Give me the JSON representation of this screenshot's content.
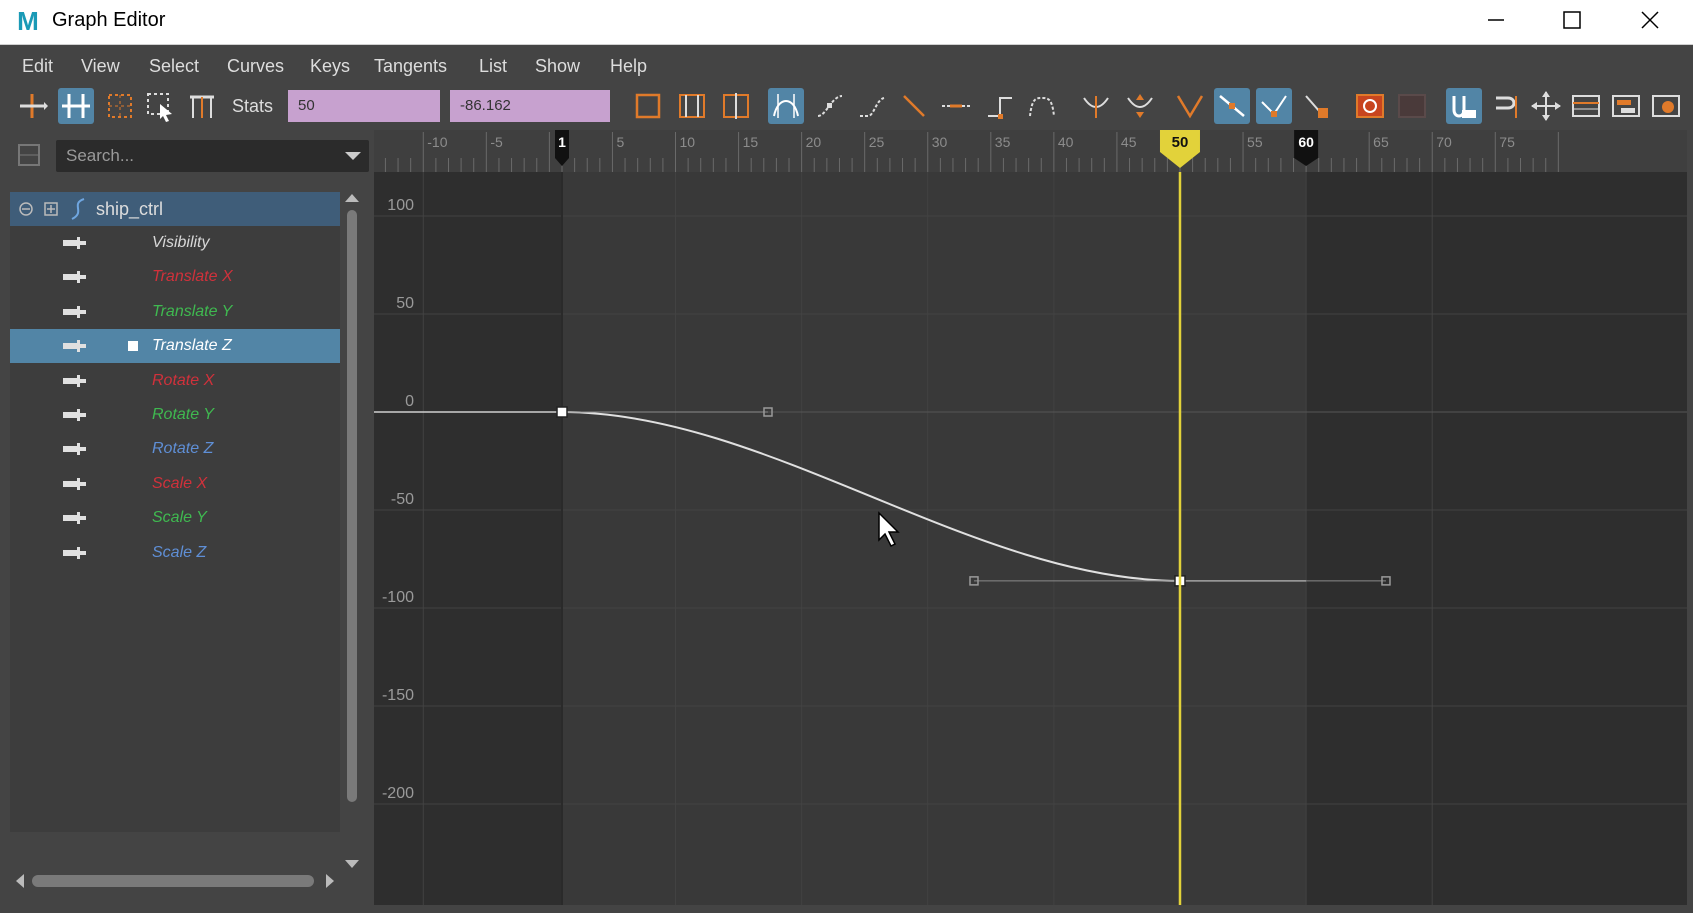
{
  "window": {
    "title": "Graph Editor",
    "logo_letter": "M",
    "controls": [
      "minimize-icon",
      "maximize-icon",
      "close-icon"
    ]
  },
  "menu": [
    "Edit",
    "View",
    "Select",
    "Curves",
    "Keys",
    "Tangents",
    "List",
    "Show",
    "Help"
  ],
  "toolbar": {
    "stats_label": "Stats",
    "frame_value": "50",
    "value_field": "-86.162",
    "tools": [
      "move-nearest-key-icon",
      "insert-keys-icon",
      "lattice-deform-icon",
      "region-select-icon",
      "retime-icon",
      "frame-all-icon",
      "frame-playback-icon",
      "center-current-time-icon",
      "auto-tangent-icon",
      "spline-tangent-icon",
      "clamped-tangent-icon",
      "linear-tangent-icon",
      "flat-tangent-icon",
      "step-tangent-icon",
      "plateau-tangent-icon",
      "buffer-curve-snapshot-icon",
      "swap-buffer-curve-icon",
      "break-tangents-icon",
      "unify-tangents-icon",
      "free-tangent-weight-icon",
      "lock-tangent-weight-icon",
      "auto-load-icon",
      "load-selected-icon",
      "time-snap-icon",
      "value-snap-icon",
      "move-key-icon",
      "dope-sheet-icon",
      "trax-editor-icon",
      "time-editor-icon"
    ]
  },
  "outliner": {
    "search_placeholder": "Search...",
    "object": "ship_ctrl",
    "attributes": [
      {
        "label": "Visibility",
        "color": "#d8d8d8",
        "selected": false
      },
      {
        "label": "Translate X",
        "color": "#d0313b",
        "selected": false
      },
      {
        "label": "Translate Y",
        "color": "#3fb950",
        "selected": false
      },
      {
        "label": "Translate Z",
        "color": "#ffffff",
        "selected": true
      },
      {
        "label": "Rotate X",
        "color": "#d0313b",
        "selected": false
      },
      {
        "label": "Rotate Y",
        "color": "#3fb950",
        "selected": false
      },
      {
        "label": "Rotate Z",
        "color": "#5f8fd6",
        "selected": false
      },
      {
        "label": "Scale X",
        "color": "#d0313b",
        "selected": false
      },
      {
        "label": "Scale Y",
        "color": "#3fb950",
        "selected": false
      },
      {
        "label": "Scale Z",
        "color": "#5f8fd6",
        "selected": false
      }
    ]
  },
  "graph": {
    "frame_ticks": [
      "-10",
      "-5",
      "5",
      "10",
      "15",
      "20",
      "25",
      "30",
      "35",
      "40",
      "45",
      "55",
      "65",
      "70",
      "75"
    ],
    "value_ticks": [
      "100",
      "50",
      "0",
      "-50",
      "-100",
      "-150",
      "-200"
    ],
    "range_start_label": "1",
    "range_end_label": "60",
    "current_frame_label": "50",
    "playback_range": [
      1,
      60
    ],
    "current_frame": 50,
    "curve": {
      "attribute": "Translate Z",
      "keys": [
        {
          "frame": 1,
          "value": 0
        },
        {
          "frame": 50,
          "value": -86.162
        }
      ]
    },
    "colors": {
      "current_time": "#e2d23a",
      "curve": "#e0e0e0",
      "selection": "#5285a6",
      "stats_field": "#c7a1cf"
    }
  }
}
